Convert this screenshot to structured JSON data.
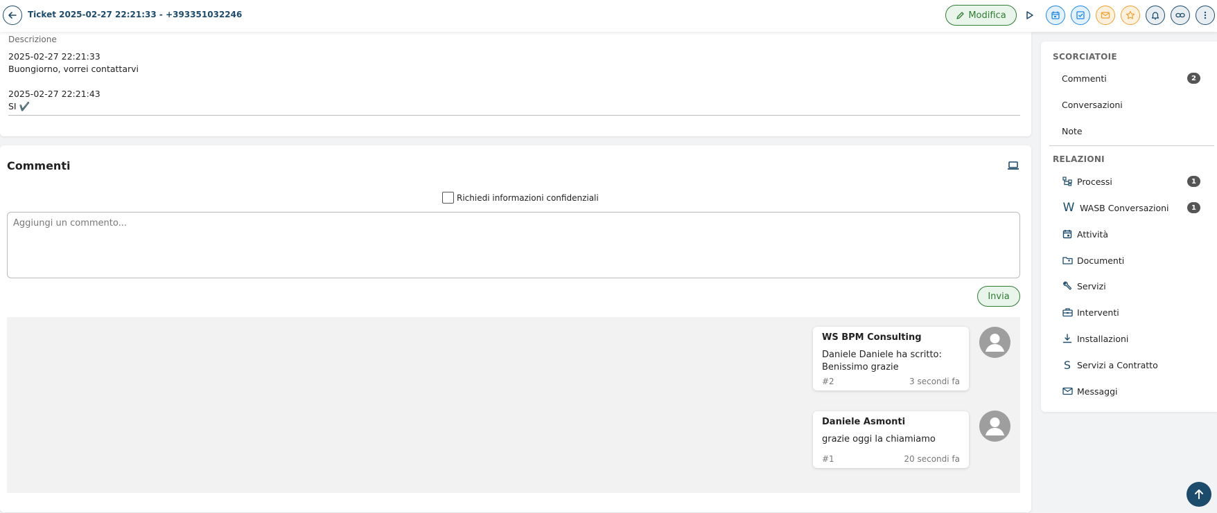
{
  "header": {
    "title": "Ticket 2025-02-27 22:21:33 - +393351032246",
    "edit_label": "Modifica",
    "icons": [
      "back-arrow-icon",
      "play-icon",
      "calendar-icon",
      "task-check-icon",
      "mail-icon",
      "star-icon",
      "bell-icon",
      "link-icon",
      "more-vertical-icon"
    ],
    "colors": {
      "primary": "#1d4b6b",
      "accent_green": "#2e7d32",
      "accent_blue": "#1e88e5",
      "accent_orange": "#f0a030"
    }
  },
  "description": {
    "label": "Descrizione",
    "lines": [
      "2025-02-27 22:21:33",
      "Buongiorno, vorrei contattarvi",
      "",
      "2025-02-27 22:21:43",
      "SI ✔️"
    ]
  },
  "comments": {
    "title": "Commenti",
    "confidential_label": "Richiedi informazioni confidenziali",
    "input_placeholder": "Aggiungi un commento...",
    "send_label": "Invia",
    "items": [
      {
        "author": "WS BPM Consulting",
        "text_line1": "Daniele Daniele ha scritto:",
        "text_line2": "Benissimo grazie",
        "number": "#2",
        "time": "3 secondi fa"
      },
      {
        "author": "Daniele Asmonti",
        "text_line1": "grazie oggi la chiamiamo",
        "text_line2": "",
        "number": "#1",
        "time": "20 secondi fa"
      }
    ]
  },
  "sidebar": {
    "shortcuts_title": "SCORCIATOIE",
    "shortcuts": [
      {
        "label": "Commenti",
        "badge": "2"
      },
      {
        "label": "Conversazioni"
      },
      {
        "label": "Note"
      }
    ],
    "relations_title": "RELAZIONI",
    "relations": [
      {
        "label": "Processi",
        "badge": "1",
        "icon": "process-tree-icon"
      },
      {
        "label": "WASB Conversazioni",
        "badge": "1",
        "icon": "w-letter-icon"
      },
      {
        "label": "Attività",
        "icon": "calendar-icon"
      },
      {
        "label": "Documenti",
        "icon": "folder-icon"
      },
      {
        "label": "Servizi",
        "icon": "wrench-icon"
      },
      {
        "label": "Interventi",
        "icon": "toolbox-icon"
      },
      {
        "label": "Installazioni",
        "icon": "download-icon"
      },
      {
        "label": "Servizi a Contratto",
        "icon": "s-letter-icon"
      },
      {
        "label": "Messaggi",
        "icon": "mail-icon"
      }
    ]
  }
}
